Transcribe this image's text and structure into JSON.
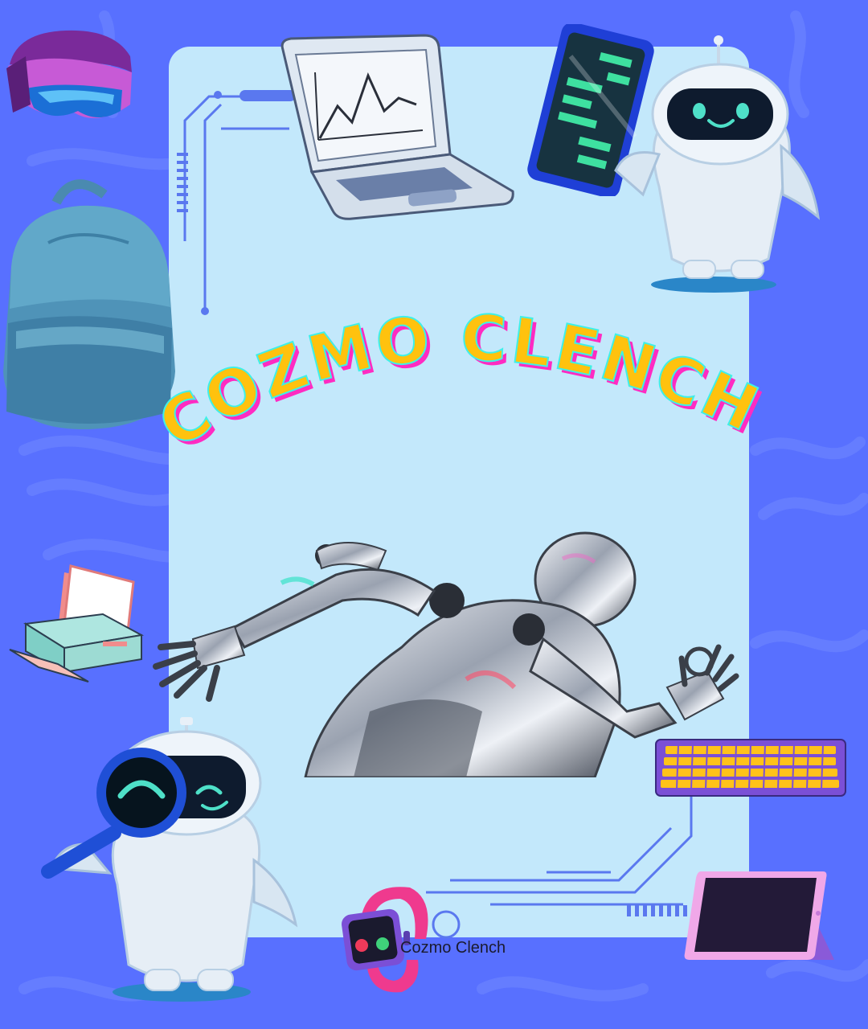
{
  "poster": {
    "title": "COZMO CLENCH",
    "caption": "Cozmo Clench"
  },
  "colors": {
    "background": "#5870ff",
    "panel": "#c3e8fb",
    "title_fill": "#ffc20e",
    "title_shadow": "#ff2bc2",
    "title_outline": "#3ef0e8"
  },
  "decorations": [
    "vr-headset-icon",
    "laptop-chart-icon",
    "smartphone-icon",
    "robot-with-phone-icon",
    "backpack-icon",
    "printer-icon",
    "humanoid-robot-image",
    "robot-with-magnifier-icon",
    "keyboard-icon",
    "smartwatch-icon",
    "tablet-icon"
  ]
}
